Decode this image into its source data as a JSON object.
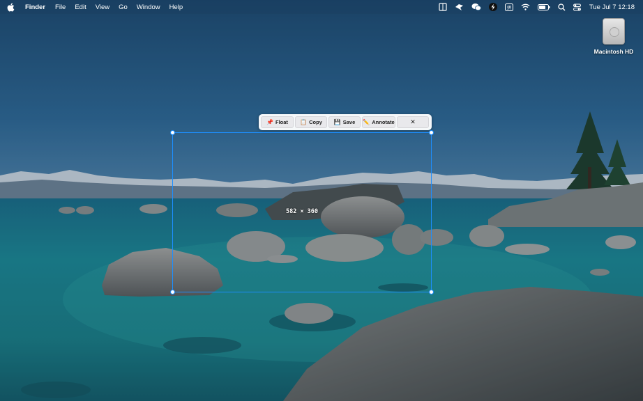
{
  "menubar": {
    "app_name": "Finder",
    "menus": [
      "File",
      "Edit",
      "View",
      "Go",
      "Window",
      "Help"
    ],
    "status_icons": [
      "reader-icon",
      "bird-icon",
      "wechat-icon",
      "bolt-icon",
      "input-source-icon",
      "wifi-icon",
      "battery-icon",
      "spotlight-icon",
      "control-center-icon"
    ],
    "clock": "Tue Jul 7  12:18"
  },
  "desktop": {
    "drive_label": "Macintosh HD"
  },
  "capture_toolbar": {
    "float": {
      "icon": "pin-icon",
      "label": "Float"
    },
    "copy": {
      "icon": "clipboard-icon",
      "label": "Copy"
    },
    "save": {
      "icon": "floppy-icon",
      "label": "Save"
    },
    "annotate": {
      "icon": "pencil-icon",
      "label": "Annotate"
    },
    "close": {
      "icon": "close-icon",
      "label": "✕"
    }
  },
  "selection": {
    "size_text": "582 × 360"
  },
  "colors": {
    "selection_accent": "#1d8fff",
    "toolbar_bg": "#ffffff"
  }
}
